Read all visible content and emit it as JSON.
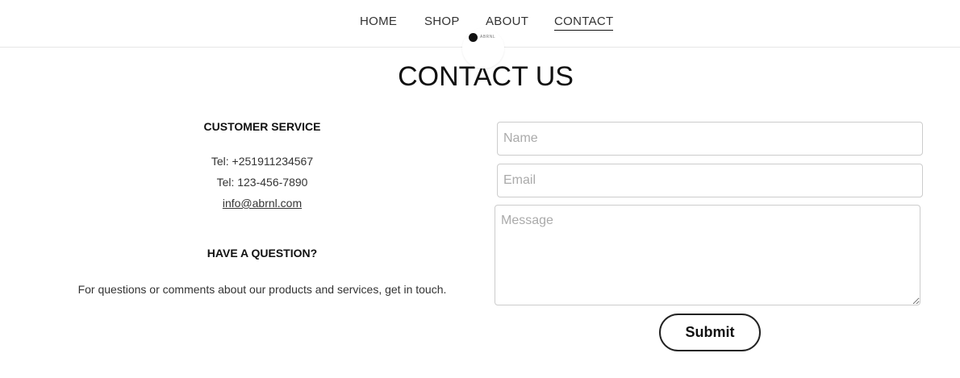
{
  "nav": {
    "items": [
      {
        "label": "HOME"
      },
      {
        "label": "SHOP"
      },
      {
        "label": "ABOUT"
      },
      {
        "label": "CONTACT"
      }
    ],
    "logo_text": "ABRNL"
  },
  "page_title": "CONTACT US",
  "customer_service": {
    "heading": "CUSTOMER SERVICE",
    "tel1": "Tel: +251911234567",
    "tel2": "Tel: 123-456-7890",
    "email": "info@abrnl.com"
  },
  "question": {
    "heading": "HAVE A QUESTION?",
    "text": "For questions or comments about our products and services, get in touch."
  },
  "form": {
    "name_placeholder": "Name",
    "email_placeholder": "Email",
    "message_placeholder": "Message",
    "submit_label": "Submit"
  }
}
